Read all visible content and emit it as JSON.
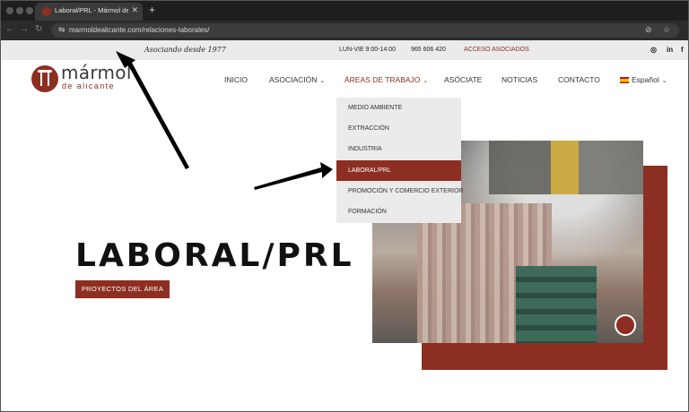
{
  "browser": {
    "tab_title": "Laboral/PRL - Mármol de Alicante",
    "tab_close": "✕",
    "new_tab": "+",
    "url": "marmoldealicante.com/relaciones-laborales/",
    "back": "←",
    "forward": "→",
    "reload": "↻",
    "tune": "⇋",
    "eye_off": "⊘",
    "star": "☆"
  },
  "infobar": {
    "tagline": "Asociando desde 1977",
    "hours": "LUN-VIE 9:00-14:00",
    "phone": "965 606 420",
    "access": "ACCESO ASOCIADOS",
    "instagram": "◎",
    "linkedin": "in",
    "facebook": "f"
  },
  "logo": {
    "name": "mármol",
    "sub": "de alicante"
  },
  "menu": {
    "inicio": "INICIO",
    "asociacion": "ASOCIACIÓN",
    "areas": "ÁREAS DE TRABAJO",
    "asociate": "ASÓCIATE",
    "noticias": "NOTICIAS",
    "contacto": "CONTACTO",
    "language": "Español",
    "caret": "⌄"
  },
  "dropdown": {
    "items": [
      "MEDIO AMBIENTE",
      "EXTRACCIÓN",
      "INDUSTRIA",
      "LABORAL/PRL",
      "PROMOCIÓN Y COMERCIO EXTERIOR",
      "FORMACIÓN"
    ]
  },
  "hero": {
    "title": "LABORAL/PRL",
    "button": "PROYECTOS DEL ÁREA"
  },
  "colors": {
    "brand": "#8c2f22",
    "infobar": "#ebebeb",
    "chrome": "#1f1f1f"
  }
}
